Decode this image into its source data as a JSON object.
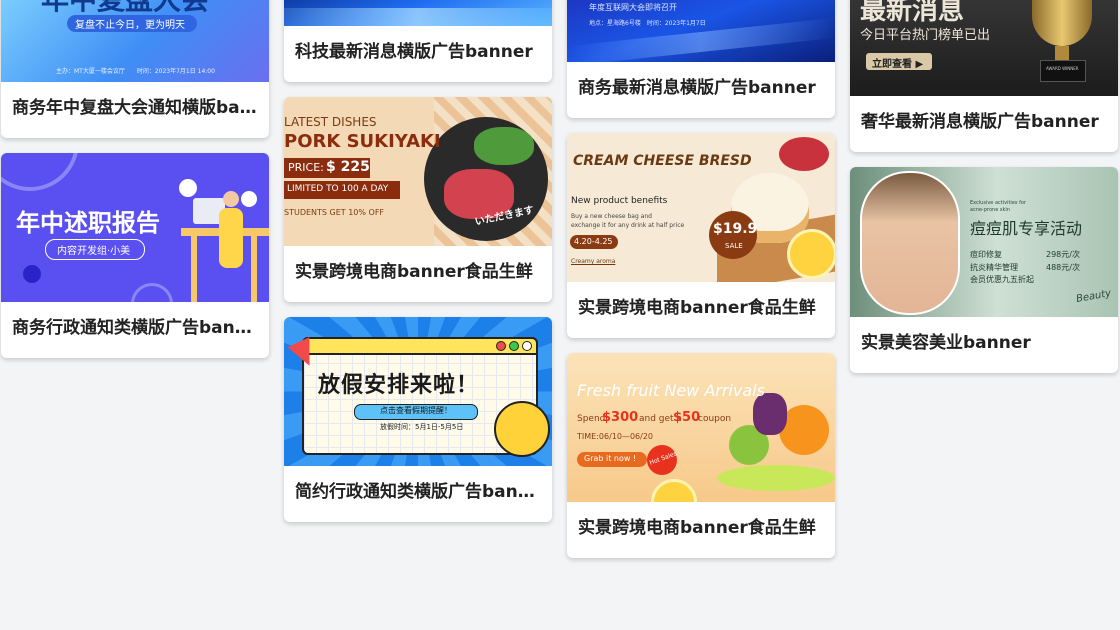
{
  "cards": [
    {
      "title": "商务年中复盘大会通知横版ba…",
      "img": {
        "headline": "年中复盘大会",
        "slogan": "复盘不止今日，更为明天",
        "info": "主办：MT大厦一楼会议厅　　时间：2023年7月1日 14:00"
      }
    },
    {
      "title": "商务行政通知类横版广告ban…",
      "img": {
        "headline": "年中述职报告",
        "sub": "内容开发组·小美"
      }
    },
    {
      "title": "科技最新消息横版广告banner",
      "img": {}
    },
    {
      "title": "实景跨境电商banner食品生鲜",
      "img": {
        "l1": "LATEST DISHES",
        "l2": "PORK SUKIYAKI",
        "price_label": "PRICE:",
        "price": "$ 225",
        "limit": "LIMITED TO 100 A DAY",
        "students": "STUDENTS GET 10% OFF",
        "jp": "いただきます"
      }
    },
    {
      "title": "简约行政通知类横版广告ban…",
      "img": {
        "headline": "放假安排来啦！",
        "btn": "点击查看假期提醒！",
        "date": "放假时间：5月1日-5月5日"
      }
    },
    {
      "title": "商务最新消息横版广告banner",
      "img": {
        "l1": "年度互联网大会即将召开",
        "l2": "地点：星海路6号楼　时间：2023年1月7日"
      }
    },
    {
      "title": "实景跨境电商banner食品生鲜",
      "img": {
        "headline": "CREAM CHEESE BRESD",
        "sub": "New product benefits",
        "desc1": "Buy a new cheese bag and",
        "desc2": "exchange it for any drink at half price",
        "date": "4.20-4.25",
        "brand": "Creamy aroma",
        "price": "$19.9",
        "sale": "SALE"
      }
    },
    {
      "title": "实景跨境电商banner食品生鲜",
      "img": {
        "headline": "Fresh fruit New Arrivals",
        "spend_a": "Spend",
        "spend_b": "$300",
        "spend_c": "and get a",
        "spend_d": "$50",
        "spend_e": "coupon",
        "time": "TIME:06/10—06/20",
        "grab": "Grab it now !",
        "hot": "Hot Sales"
      }
    },
    {
      "title": "奢华最新消息横版广告banner",
      "img": {
        "headline": "最新消息",
        "sub": "今日平台热门榜单已出",
        "btn": "立即查看 ▶",
        "plate": "AWARD WINNER"
      }
    },
    {
      "title": "实景美容美业banner",
      "img": {
        "small1": "Exclusive activities for",
        "small2": "acne-prone skin",
        "headline": "痘痘肌专享活动",
        "r1a": "痘印修复",
        "r1b": "298元/次",
        "r2a": "抗炎精华管理",
        "r2b": "488元/次",
        "r3": "会员优惠九五折起",
        "sign": "Beauty"
      }
    }
  ],
  "colors": {
    "background": "#f3f4f6",
    "card": "#ffffff",
    "title_text": "#222222"
  }
}
